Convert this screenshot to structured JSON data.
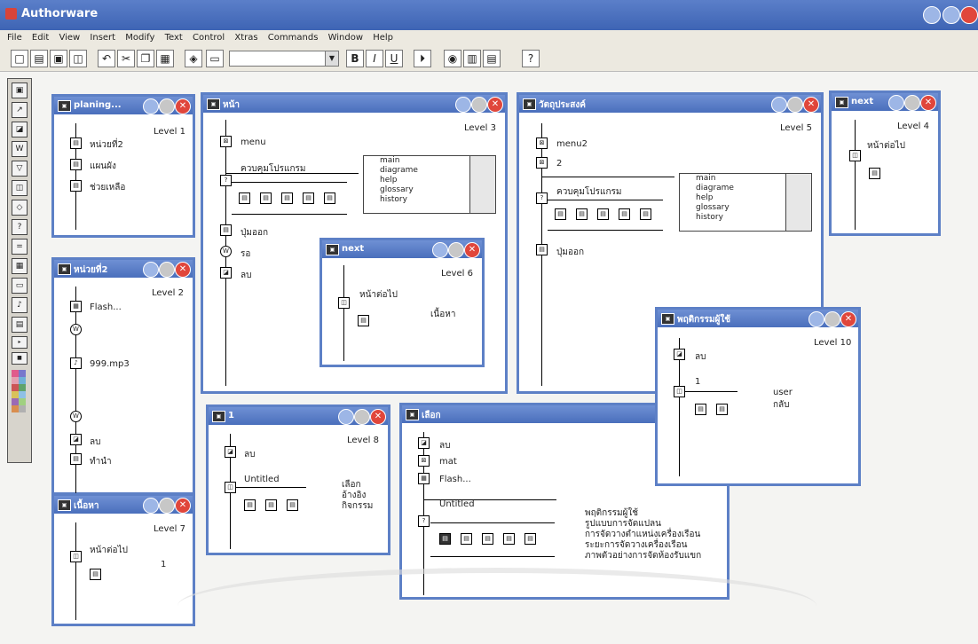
{
  "app": {
    "title": "Authorware"
  },
  "menu": [
    "File",
    "Edit",
    "View",
    "Insert",
    "Modify",
    "Text",
    "Control",
    "Xtras",
    "Commands",
    "Window",
    "Help"
  ],
  "toolbar": {
    "buttons_left": [
      "new-icon",
      "open-icon",
      "save-all-icon",
      "import-icon",
      "undo-icon",
      "cut-icon",
      "copy-icon",
      "paste-icon"
    ],
    "buttons_right": [
      "bold-icon",
      "italic-icon",
      "underline-icon",
      "restart-icon",
      "run-icon",
      "functions-icon",
      "variables-icon",
      "help-icon"
    ],
    "combo_value": ""
  },
  "windows": {
    "planing": {
      "title": "planing...",
      "level": "Level 1",
      "items": [
        "หน่วยที่2",
        "แผนผัง",
        "ช่วยเหลือ"
      ]
    },
    "menu_win": {
      "title": "หน้า",
      "level": "Level 3",
      "items": {
        "menu": "menu",
        "control": "ควบคุมโปรแกรม",
        "exit": "ปุ่มออก",
        "wait": "รอ",
        "erase": "ลบ"
      },
      "list": [
        "main",
        "diagrame",
        "help",
        "glossary",
        "history"
      ]
    },
    "objective": {
      "title": "วัตถุประสงค์",
      "level": "Level 5",
      "items": {
        "menu2": "menu2",
        "two": "2",
        "control": "ควบคุมโปรแกรม",
        "exit": "ปุ่มออก"
      },
      "list": [
        "main",
        "diagrame",
        "help",
        "glossary",
        "history"
      ]
    },
    "next1": {
      "title": "next",
      "level": "Level 4",
      "item": "หน้าต่อไป"
    },
    "unit2": {
      "title": "หน่วยที่2",
      "level": "Level 2",
      "items": {
        "flash": "Flash...",
        "mp3": "999.mp3",
        "erase": "ลบ",
        "main": "ทำนำ"
      }
    },
    "next2": {
      "title": "next",
      "level": "Level 6",
      "item": "หน้าต่อไป",
      "content": "เนื้อหา"
    },
    "behavior": {
      "title": "พฤติกรรมผู้ใช้",
      "level": "Level 10",
      "erase": "ลบ",
      "one": "1",
      "user": "user",
      "back": "กลับ"
    },
    "content_win": {
      "title": "เนื้อหา",
      "level": "Level 7",
      "item": "หน้าต่อไป",
      "one": "1"
    },
    "one_win": {
      "title": "1",
      "level": "Level 8",
      "erase": "ลบ",
      "untitled": "Untitled",
      "choices": [
        "เลือก",
        "อ้างอิง",
        "กิจกรรม"
      ]
    },
    "choose": {
      "title": "เลือก",
      "erase": "ลบ",
      "mat": "mat",
      "flash": "Flash...",
      "untitled": "Untitled",
      "notes": [
        "พฤติกรรมผู้ใช้",
        "รูปแบบการจัดแปลน",
        "การจัดวางตำแหน่งเครื่องเรือน",
        "ระยะการจัดวางเครื่องเรือน",
        "ภาพตัวอย่างการจัดห้องรับแขก"
      ]
    }
  },
  "colors": {
    "titlebar": "#3e64b4",
    "window_border": "#5d80c6",
    "close": "#e0463b"
  }
}
